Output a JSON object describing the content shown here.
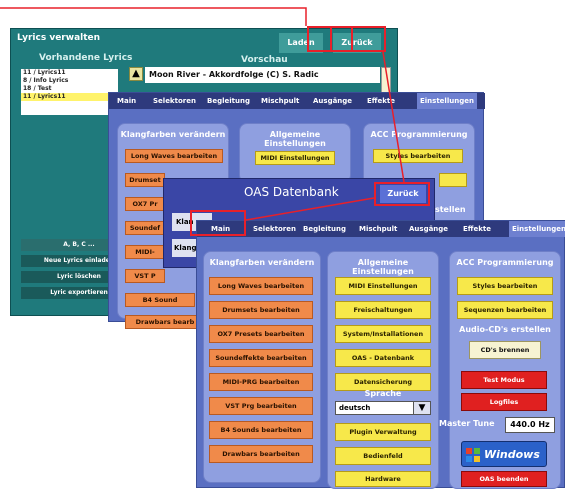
{
  "lyrics_window": {
    "title": "Lyrics verwalten",
    "load_label": "Laden",
    "back_label": "Zurück",
    "list_header": "Vorhandene Lyrics",
    "preview_header": "Vorschau",
    "items": [
      "11 / Lyrics11",
      "8 / Info Lyrics",
      "18 / Test",
      "11 / Lyrics11"
    ],
    "preview_text": "Moon River - Akkordfolge (C) S. Radic",
    "abc_label": "A, B, C ...",
    "load_new_label": "Neue Lyrics einladen",
    "delete_label": "Lyric löschen",
    "export_label": "Lyric exportieren"
  },
  "settings_back": {
    "menu": [
      "Main",
      "Selektoren",
      "Begleitung",
      "Mischpult",
      "Ausgänge",
      "Effekte",
      "Einstellungen"
    ],
    "panel1_title": "Klangfarben verändern",
    "panel1_buttons": [
      "Long Waves bearbeiten",
      "Drumset",
      "OX7 Pr",
      "Soundef",
      "MIDI-",
      "VST P",
      "B4 Sound",
      "Drawbars  bearb"
    ],
    "panel2_title": "Allgemeine Einstellungen",
    "panel2_buttons": [
      "MIDI Einstellungen"
    ],
    "panel3_title": "ACC Programmierung",
    "panel3_buttons": [
      "Styles bearbeiten"
    ],
    "panel3_extra": "rstellen"
  },
  "oas_dialog": {
    "title": "OAS Datenbank",
    "back_label": "Zurück",
    "side_labels": [
      "Klan",
      "Klangf"
    ]
  },
  "settings_front": {
    "menu": [
      "Main",
      "Selektoren",
      "Begleitung",
      "Mischpult",
      "Ausgänge",
      "Effekte",
      "Einstellungen"
    ],
    "panel1_title": "Klangfarben verändern",
    "panel1_buttons": [
      "Long Waves bearbeiten",
      "Drumsets bearbeiten",
      "OX7 Presets bearbeiten",
      "Soundeffekte bearbeiten",
      "MIDI-PRG bearbeiten",
      "VST Prg  bearbeiten",
      "B4 Sounds  bearbeiten",
      "Drawbars  bearbeiten"
    ],
    "panel2_title": "Allgemeine Einstellungen",
    "panel2_buttons": [
      "MIDI Einstellungen",
      "Freischaltungen",
      "System/Installationen",
      "OAS - Datenbank",
      "Datensicherung"
    ],
    "language_label": "Sprache",
    "language_value": "deutsch",
    "panel2_buttons_b": [
      "Plugin Verwaltung",
      "Bedienfeld",
      "Hardware"
    ],
    "panel3_title": "ACC Programmierung",
    "panel3_buttons": [
      "Styles bearbeiten",
      "Sequenzen bearbeiten"
    ],
    "audio_title": "Audio-CD's erstellen",
    "burn_label": "CD's brennen",
    "test_label": "Test Modus",
    "logfiles_label": "Logfiles",
    "master_tune_label": "Master Tune",
    "master_tune_value": "440.0 Hz",
    "windows_label": "Windows",
    "quit_label": "OAS beenden"
  },
  "colors": {
    "highlight": "#e8202a",
    "orange_button": "#f08a4a",
    "yellow_button": "#f7e84a",
    "red_button": "#e02020"
  }
}
